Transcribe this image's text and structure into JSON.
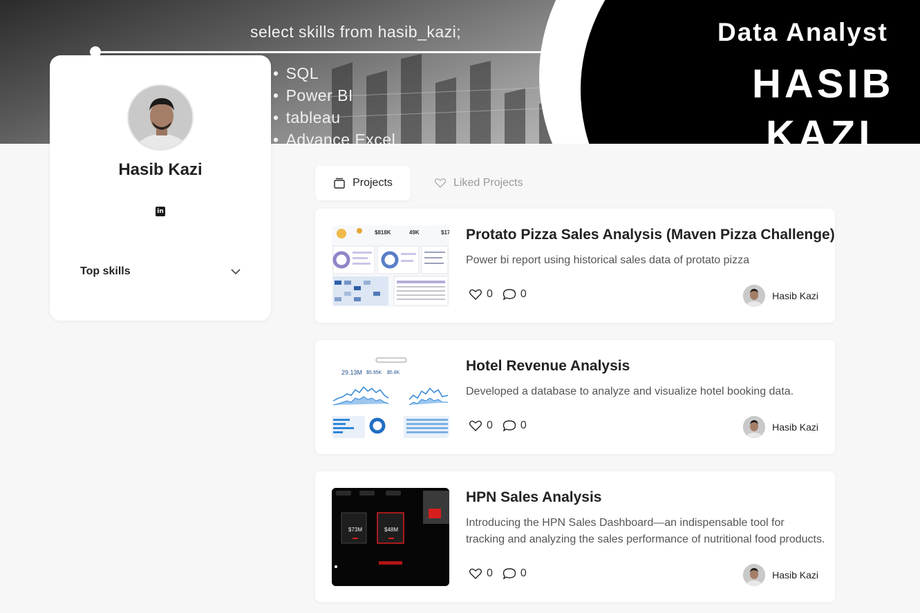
{
  "banner": {
    "query": "select skills from hasib_kazi;",
    "skills": [
      "SQL",
      "Power BI",
      "tableau",
      "Advance Excel"
    ],
    "role": "Data Analyst",
    "name_line1": "HASIB",
    "name_line2": "KAZI"
  },
  "profile": {
    "name": "Hasib Kazi",
    "linkedin_icon": "linkedin-icon",
    "top_skills_label": "Top skills"
  },
  "tabs": [
    {
      "label": "Projects",
      "icon": "folder-icon",
      "active": true
    },
    {
      "label": "Liked Projects",
      "icon": "heart-icon",
      "active": false
    }
  ],
  "projects": [
    {
      "title": "Protato Pizza Sales Analysis (Maven Pizza Challenge)",
      "description": "Power bi report using historical sales data of protato pizza",
      "likes": "0",
      "comments": "0",
      "author": "Hasib Kazi",
      "thumb_kpis": [
        "$818K",
        "49K",
        "$17"
      ]
    },
    {
      "title": "Hotel Revenue Analysis",
      "description": "Developed a database to analyze and visualize hotel booking data.",
      "likes": "0",
      "comments": "0",
      "author": "Hasib Kazi",
      "thumb_kpis": [
        "29.13M",
        "$5.95K",
        "$5.8K"
      ]
    },
    {
      "title": "HPN Sales Analysis",
      "description": "Introducing the HPN Sales Dashboard—an indispensable tool for tracking and analyzing the sales performance of nutritional food products.",
      "likes": "0",
      "comments": "0",
      "author": "Hasib Kazi",
      "thumb_kpis": [
        "$73M",
        "$48M"
      ]
    }
  ],
  "colors": {
    "page_bg": "#f7f7f7",
    "card_bg": "#ffffff",
    "text": "#222222",
    "muted": "#999999",
    "dashboard_blue": "#2f86d6",
    "hpn_red": "#d81e1e"
  }
}
